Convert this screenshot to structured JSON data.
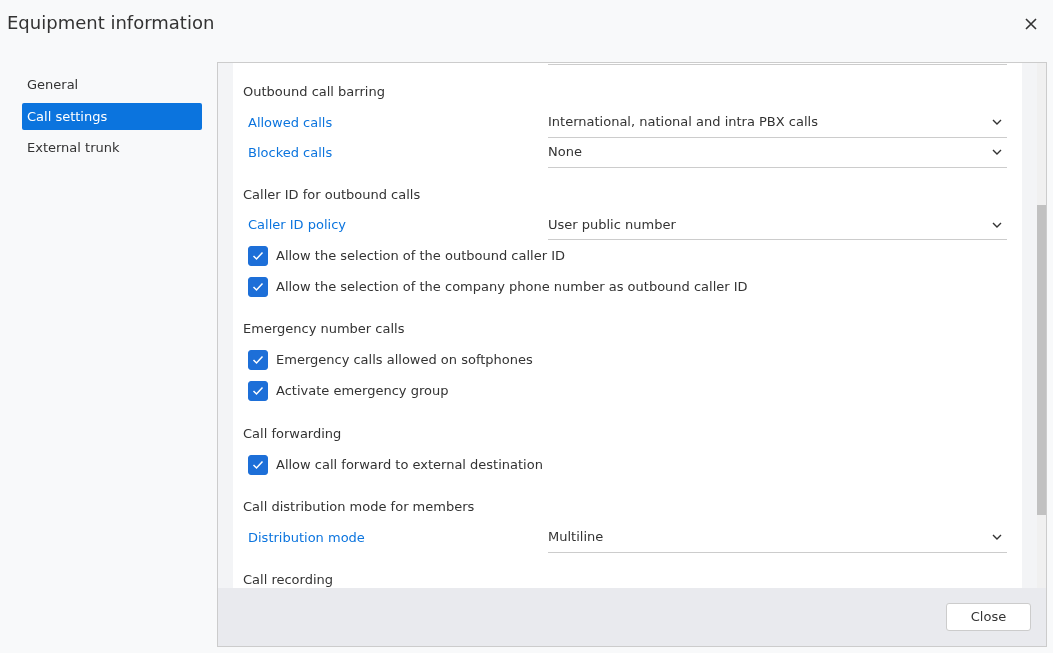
{
  "window": {
    "title": "Equipment information"
  },
  "sidebar": {
    "items": [
      {
        "label": "General",
        "selected": false
      },
      {
        "label": "Call settings",
        "selected": true
      },
      {
        "label": "External trunk",
        "selected": false
      }
    ]
  },
  "sections": [
    {
      "title": "Outbound call barring",
      "items": [
        {
          "kind": "select",
          "label": "Allowed calls",
          "value": "International, national and intra PBX calls"
        },
        {
          "kind": "select",
          "label": "Blocked calls",
          "value": "None"
        }
      ]
    },
    {
      "title": "Caller ID for outbound calls",
      "items": [
        {
          "kind": "select",
          "label": "Caller ID policy",
          "value": "User public number"
        },
        {
          "kind": "checkbox",
          "label": "Allow the selection of the outbound caller ID",
          "checked": true
        },
        {
          "kind": "checkbox",
          "label": "Allow the selection of the company phone number as outbound caller ID",
          "checked": true
        }
      ]
    },
    {
      "title": "Emergency number calls",
      "items": [
        {
          "kind": "checkbox",
          "label": "Emergency calls allowed on softphones",
          "checked": true
        },
        {
          "kind": "checkbox",
          "label": "Activate emergency group",
          "checked": true
        }
      ]
    },
    {
      "title": "Call forwarding",
      "items": [
        {
          "kind": "checkbox",
          "label": "Allow call forward to external destination",
          "checked": true
        }
      ]
    },
    {
      "title": "Call distribution mode for members",
      "items": [
        {
          "kind": "select",
          "label": "Distribution mode",
          "value": "Multiline"
        }
      ]
    },
    {
      "title": "Call recording"
    }
  ],
  "buttons": [
    "Close"
  ]
}
